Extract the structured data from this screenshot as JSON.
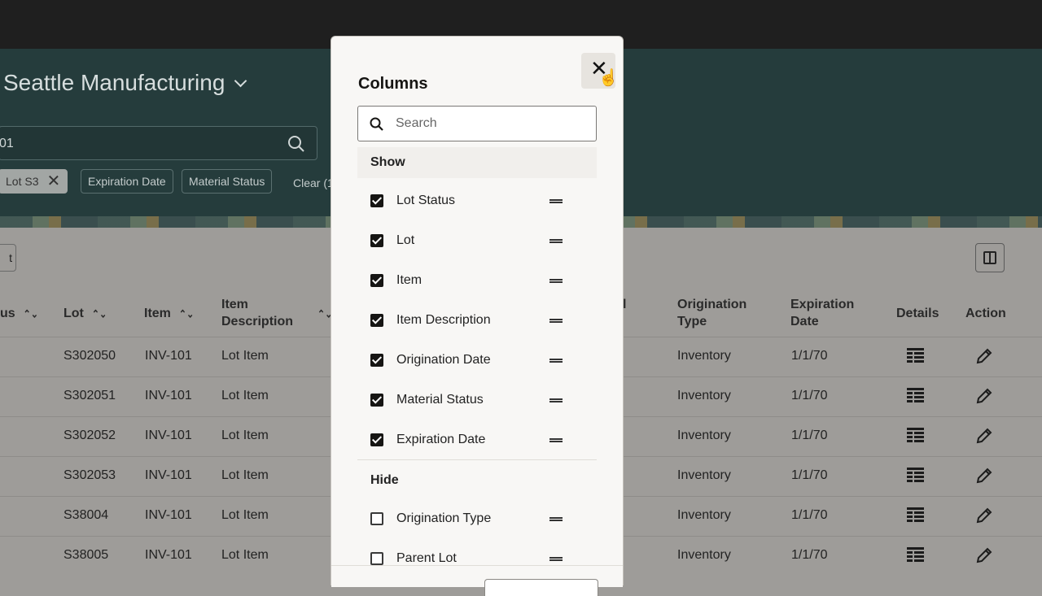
{
  "header": {
    "org_name": "Seattle Manufacturing",
    "search_value": "01",
    "chips": [
      "Lot S3",
      "Expiration Date",
      "Material Status"
    ],
    "clear_label": "Clear (1"
  },
  "toolbar": {
    "left_button_label": "t"
  },
  "table": {
    "headers": {
      "status": "us",
      "lot": "Lot",
      "item": "Item",
      "item_desc_1": "Item",
      "item_desc_2": "Description",
      "hidden_partial": "l",
      "orig_type_1": "Origination",
      "orig_type_2": "Type",
      "exp_1": "Expiration",
      "exp_2": "Date",
      "details": "Details",
      "action": "Action"
    },
    "rows": [
      {
        "lot": "S302050",
        "item": "INV-101",
        "desc": "Lot Item",
        "orig_type": "Inventory",
        "exp": "1/1/70"
      },
      {
        "lot": "S302051",
        "item": "INV-101",
        "desc": "Lot Item",
        "orig_type": "Inventory",
        "exp": "1/1/70"
      },
      {
        "lot": "S302052",
        "item": "INV-101",
        "desc": "Lot Item",
        "orig_type": "Inventory",
        "exp": "1/1/70"
      },
      {
        "lot": "S302053",
        "item": "INV-101",
        "desc": "Lot Item",
        "orig_type": "Inventory",
        "exp": "1/1/70"
      },
      {
        "lot": "S38004",
        "item": "INV-101",
        "desc": "Lot Item",
        "orig_type": "Inventory",
        "exp": "1/1/70"
      },
      {
        "lot": "S38005",
        "item": "INV-101",
        "desc": "Lot Item",
        "orig_type": "Inventory",
        "exp": "1/1/70"
      }
    ]
  },
  "dialog": {
    "title": "Columns",
    "search_placeholder": "Search",
    "show_label": "Show",
    "hide_label": "Hide",
    "show_items": [
      "Lot Status",
      "Lot",
      "Item",
      "Item Description",
      "Origination Date",
      "Material Status",
      "Expiration Date"
    ],
    "hide_items": [
      "Origination Type",
      "Parent Lot"
    ]
  }
}
